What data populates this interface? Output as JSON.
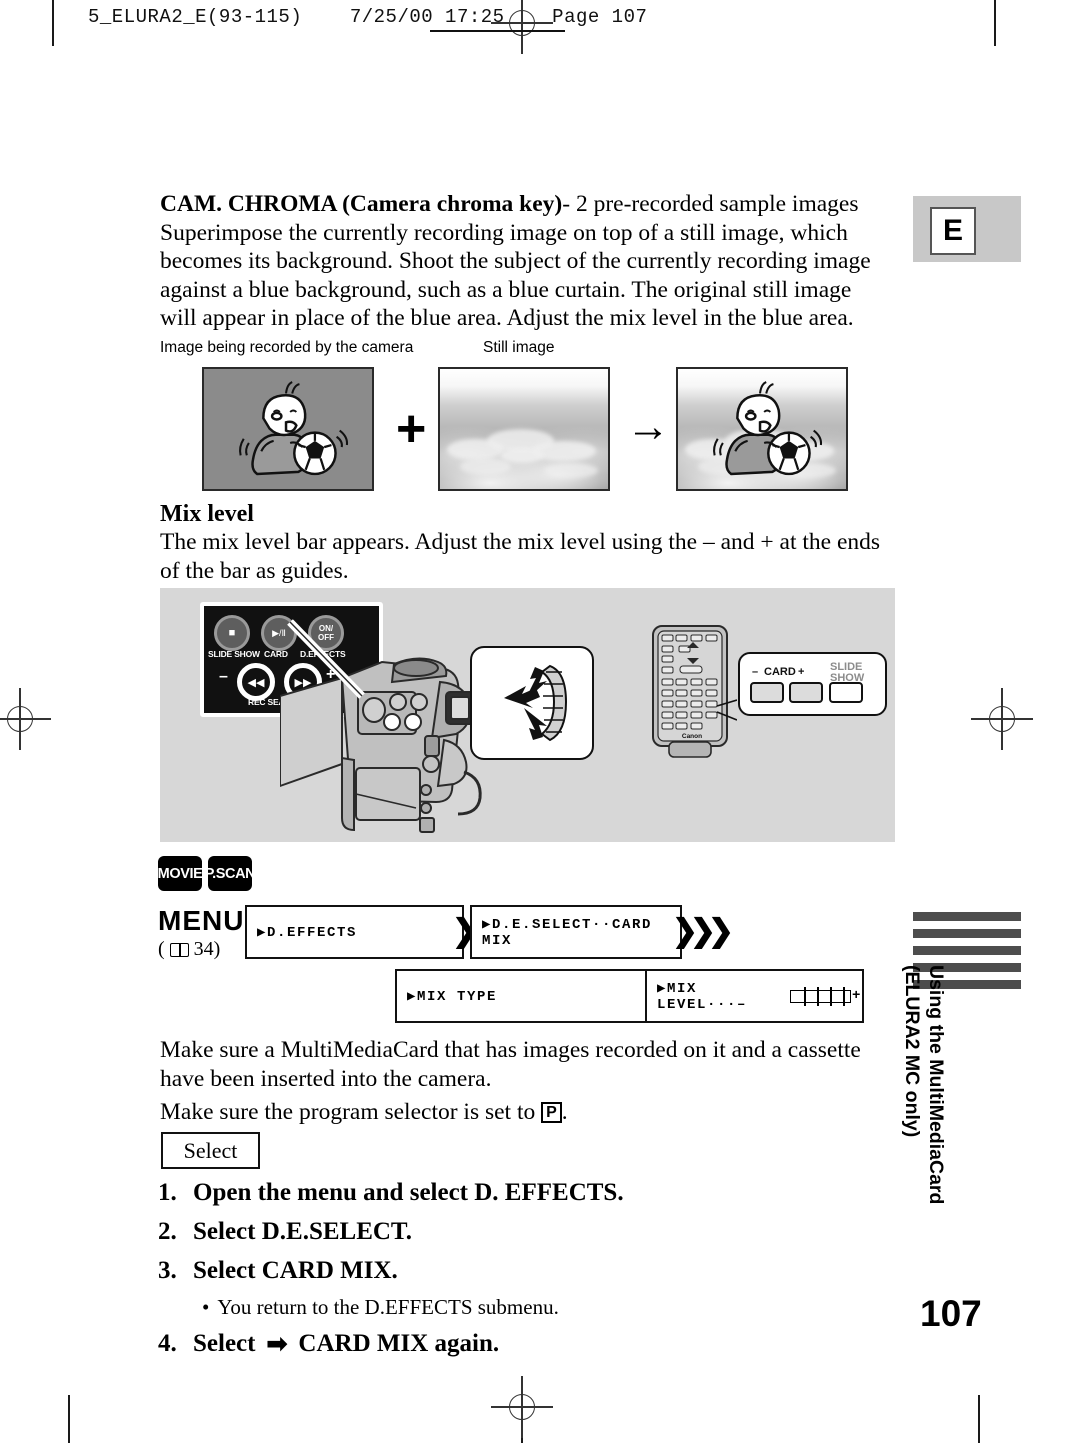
{
  "print_header": {
    "text": "5_ELURA2_E(93-115)    7/25/00 17:25    Page 107"
  },
  "language_badge": {
    "letter": "E"
  },
  "intro": {
    "bold_lead": "CAM. CHROMA (Camera chroma key)",
    "rest": "- 2 pre-recorded sample images Superimpose the currently recording image on top of a still image, which becomes its background. Shoot the subject of the currently recording image against a blue background, such as a blue curtain. The original still image will appear in place of the blue area. Adjust the mix level in the blue area."
  },
  "captions": {
    "recording": "Image being recorded by the camera",
    "still": "Still image",
    "plus": "+",
    "arrow": "→"
  },
  "mix_level": {
    "heading": "Mix level",
    "body": "The mix level bar appears. Adjust the mix level using the – and + at the ends of the bar as guides."
  },
  "lcd_panel": {
    "stop_glyph": "■",
    "play_pause_glyph": "▶/Ⅱ",
    "onoff_line1": "ON/",
    "onoff_line2": "OFF",
    "label_slide_show": "SLIDE SHOW",
    "label_card": "CARD",
    "label_d_effects": "D.EFFECTS",
    "rew_glyph": "◀◀",
    "ff_glyph": "▶▶",
    "minus": "–",
    "plus": "+",
    "label_rec_search": "REC SEARCH"
  },
  "remote_callout": {
    "minus": "–",
    "card": "CARD",
    "plus": "+",
    "slide_line1": "SLIDE",
    "slide_line2": "SHOW",
    "brand": "Canon"
  },
  "mode_badges": [
    {
      "label": "MOVIE"
    },
    {
      "label": "P.SCAN"
    }
  ],
  "menu": {
    "word": "MENU",
    "ref_prefix": "(",
    "ref_page": "34)",
    "screens": [
      {
        "id": "d-effects",
        "text": "▶D.EFFECTS"
      },
      {
        "id": "de-select",
        "text": "▶D.E.SELECT··CARD MIX"
      },
      {
        "id": "mix-type",
        "text": "▶MIX TYPE"
      },
      {
        "id": "mix-level",
        "prefix": "▶MIX LEVEL···–",
        "suffix": "+"
      }
    ],
    "chevron_single": "❯",
    "chevron_triple": "❯❯❯"
  },
  "notes": {
    "note1": "Make sure a MultiMediaCard that has images recorded on it and a cassette have been inserted into the camera.",
    "note2_before": "Make sure the program selector is set to ",
    "note2_key": "P",
    "note2_after": "."
  },
  "select_button": {
    "label": "Select"
  },
  "steps": [
    {
      "num": "1.",
      "text": "Open the menu and select D. EFFECTS."
    },
    {
      "num": "2.",
      "text": "Select D.E.SELECT."
    },
    {
      "num": "3.",
      "text": "Select CARD MIX."
    },
    {
      "num": "4.",
      "arrow": "➡",
      "text_before": "Select ",
      "text_after": "CARD MIX again."
    }
  ],
  "sub_bullet": {
    "bullet": "•",
    "text": "You return to the D.EFFECTS submenu."
  },
  "side_tab": {
    "line1": "Using the MultiMediaCard",
    "line2": "(ELURA2 MC only)",
    "bar_count": 5,
    "bar_color": "#4d4d4d"
  },
  "page_number": "107"
}
